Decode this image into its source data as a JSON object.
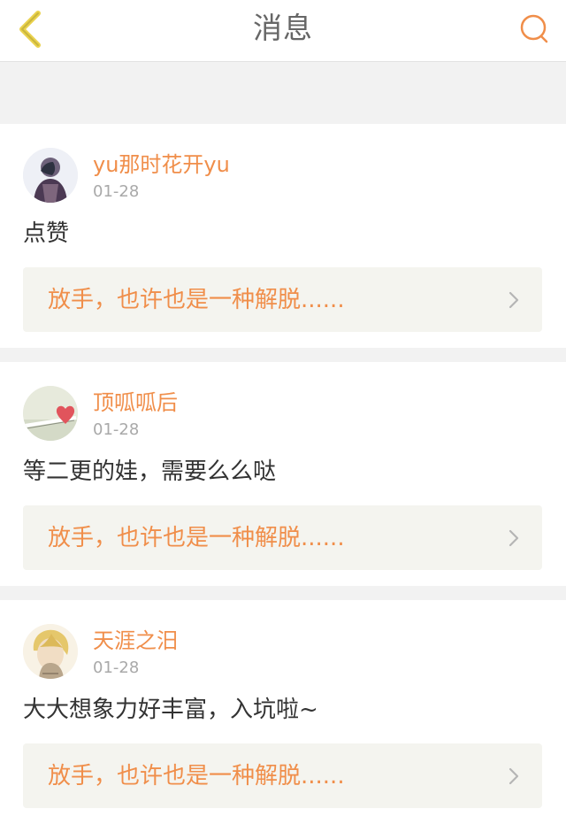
{
  "header": {
    "title": "消息",
    "back_icon": "chevron-left-icon",
    "search_icon": "search-icon"
  },
  "colors": {
    "accent": "#f08e4a",
    "text": "#333333",
    "muted": "#a9a9a9",
    "quote_background": "#f4f4ef",
    "page_background": "#f2f2f2"
  },
  "messages": [
    {
      "username": "yu那时花开yu",
      "date": "01-28",
      "comment": "点赞",
      "quote": "放手，也许也是一种解脱......",
      "avatar_icon": "user-avatar-icon"
    },
    {
      "username": "顶呱呱后",
      "date": "01-28",
      "comment": "等二更的娃，需要么么哒",
      "quote": "放手，也许也是一种解脱......",
      "avatar_icon": "heart-avatar-icon"
    },
    {
      "username": "天涯之汨",
      "date": "01-28",
      "comment": "大大想象力好丰富，入坑啦~",
      "quote": "放手，也许也是一种解脱......",
      "avatar_icon": "anime-avatar-icon"
    }
  ]
}
